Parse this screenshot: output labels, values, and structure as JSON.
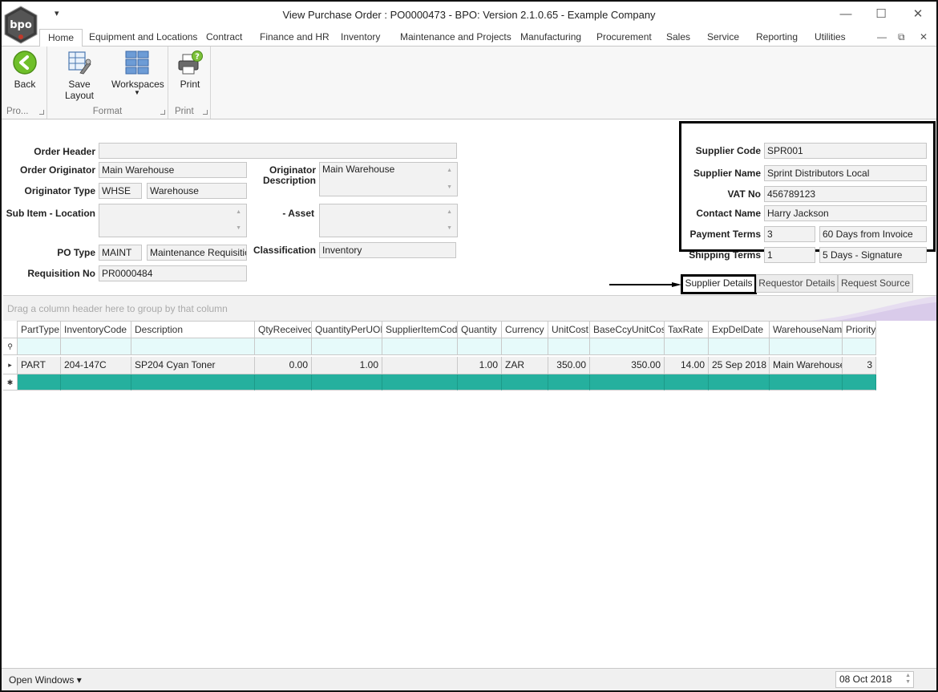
{
  "app": {
    "title": "View Purchase Order : PO0000473 - BPO: Version 2.1.0.65 - Example Company",
    "logo_text": "bpo",
    "qat_glyph": "▾",
    "controls": {
      "minimize": "—",
      "maximize": "☐",
      "close": "✕"
    },
    "mdi_controls": {
      "minimize": "—",
      "restore": "⧉",
      "close": "✕"
    }
  },
  "ribbon": {
    "tabs": [
      "Home",
      "Equipment and Locations",
      "Contract",
      "Finance and HR",
      "Inventory",
      "Maintenance and Projects",
      "Manufacturing",
      "Procurement",
      "Sales",
      "Service",
      "Reporting",
      "Utilities"
    ],
    "groups": {
      "process": {
        "label": "Pro...",
        "back_label": "Back"
      },
      "format": {
        "label": "Format",
        "save_layout_label": "Save Layout",
        "workspaces_label": "Workspaces"
      },
      "print": {
        "label": "Print",
        "print_label": "Print"
      }
    }
  },
  "form": {
    "order_header": {
      "label": "Order Header",
      "value": ""
    },
    "order_originator": {
      "label": "Order Originator",
      "value": "Main Warehouse"
    },
    "originator_type": {
      "label": "Originator Type",
      "code": "WHSE",
      "value": "Warehouse"
    },
    "sub_item_location": {
      "label": "Sub Item - Location",
      "value": ""
    },
    "originator_description": {
      "label1": "Originator",
      "label2": "Description",
      "value": "Main Warehouse"
    },
    "asset": {
      "label": "- Asset",
      "value": ""
    },
    "po_type": {
      "label": "PO Type",
      "code": "MAINT",
      "value": "Maintenance Requisition"
    },
    "classification": {
      "label": "Classification",
      "value": "Inventory"
    },
    "requisition_no": {
      "label": "Requisition No",
      "value": "PR0000484"
    }
  },
  "supplier": {
    "supplier_code": {
      "label": "Supplier Code",
      "value": "SPR001"
    },
    "supplier_name": {
      "label": "Supplier Name",
      "value": "Sprint Distributors Local"
    },
    "vat_no": {
      "label": "VAT No",
      "value": "456789123"
    },
    "contact_name": {
      "label": "Contact Name",
      "value": "Harry Jackson"
    },
    "payment_terms": {
      "label": "Payment Terms",
      "code": "3",
      "value": "60 Days from Invoice"
    },
    "shipping_terms": {
      "label": "Shipping Terms",
      "code": "1",
      "value": "5 Days - Signature"
    }
  },
  "subtabs": [
    "Supplier Details",
    "Requestor Details",
    "Request Source"
  ],
  "grid": {
    "group_hint": "Drag a column header here to group by that column",
    "columns": [
      "PartType",
      "InventoryCode",
      "Description",
      "QtyReceived",
      "QuantityPerUOP",
      "SupplierItemCode",
      "Quantity",
      "Currency",
      "UnitCost",
      "BaseCcyUnitCost",
      "TaxRate",
      "ExpDelDate",
      "WarehouseName",
      "Priority"
    ],
    "rows": [
      [
        "PART",
        "204-147C",
        "SP204 Cyan Toner",
        "0.00",
        "1.00",
        "",
        "1.00",
        "ZAR",
        "350.00",
        "350.00",
        "14.00",
        "25 Sep 2018",
        "Main Warehouse",
        "3"
      ]
    ],
    "indicators": {
      "filter": "⚲",
      "current": "▸",
      "new": "✱"
    }
  },
  "status": {
    "open_windows": "Open Windows ▾",
    "date": "08 Oct 2018"
  },
  "colors": {
    "new_row": "#25b09e",
    "filter_row": "#e6fafa",
    "highlight_border": "#000000"
  }
}
